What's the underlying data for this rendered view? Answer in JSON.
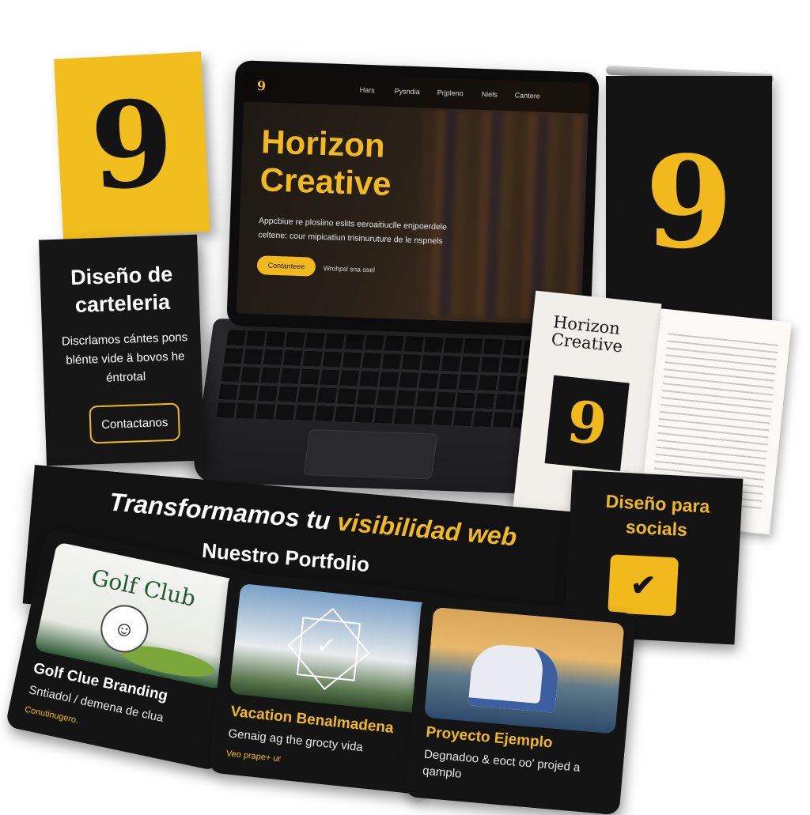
{
  "brand": {
    "logo_mark": "9",
    "name_line1": "Horizon",
    "name_line2": "Creative",
    "accent_color": "#f2b91c",
    "dark_color": "#141414"
  },
  "poster": {
    "title": "Diseño de carteleria",
    "body": "Discrlamos cántes pons blénte vide ä bovos he éntrotal",
    "button": "Contactanos"
  },
  "laptop": {
    "logo": "9",
    "nav": [
      "Hars",
      "Pysndia",
      "Prjpleno",
      "Niels",
      "Cantere"
    ],
    "hero_title_line1": "Horizon",
    "hero_title_line2": "Creative",
    "hero_subtitle": "Appcbiue re plosiino eslits eeroaitiuclle enjpoerdele celtene: cour mipicatiun trisinuruture de le nspnels",
    "hero_button": "Contanteee",
    "hero_link": "Wrohpsl sna osel"
  },
  "banner": {
    "mark": "9"
  },
  "brochure": {
    "title_line1": "Horizon",
    "title_line2": "Creative",
    "mark": "9"
  },
  "tagline": {
    "line1_white": "Transformamos tu ",
    "line1_highlight": "visibilidad web",
    "line2": "Nuestro Portfolio"
  },
  "social": {
    "title": "Diseño para socials",
    "icon": "check-icon"
  },
  "portfolio": [
    {
      "image_text": "Golf Club",
      "title": "Golf Clue Branding",
      "subtitle": "Sntiadol / demena de clua",
      "link": "Conutinugero."
    },
    {
      "title": "Vacation Benalmadena",
      "subtitle": "Genaig ag the grocty vida",
      "link": "Veo prape+ ur"
    },
    {
      "title": "Proyecto Ejemplo",
      "subtitle": "Degnadoo & eoct oo' projed a qamplo"
    }
  ]
}
